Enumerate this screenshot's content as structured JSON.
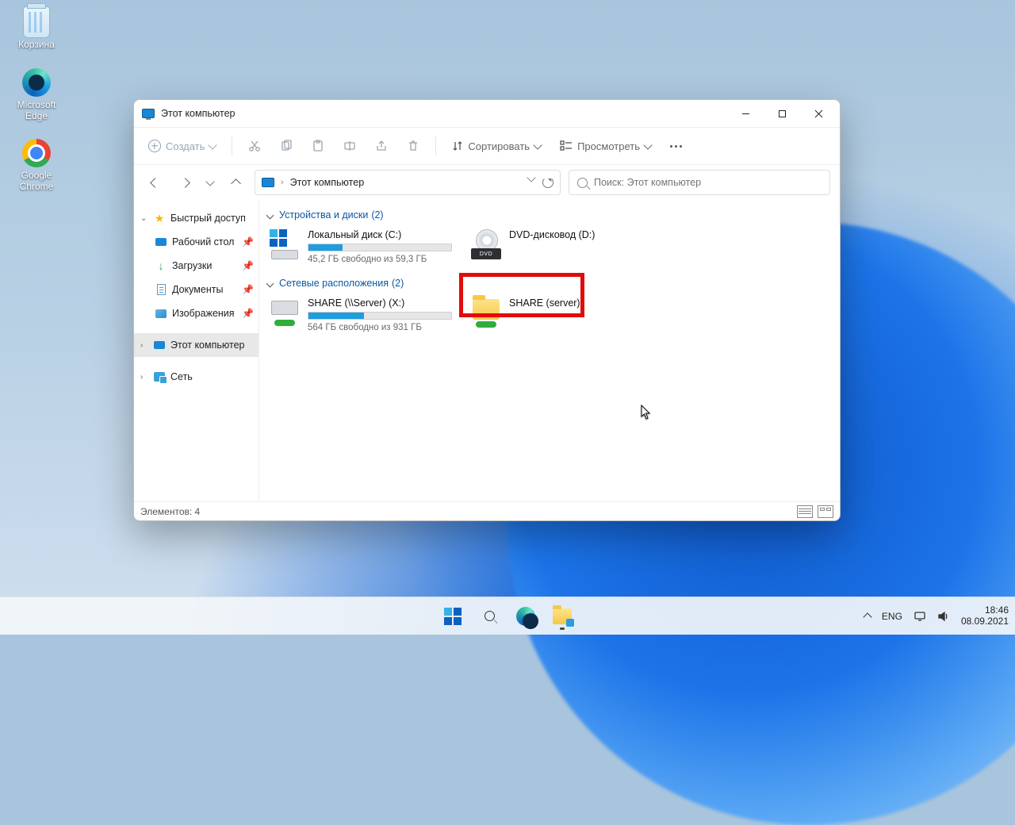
{
  "desktop": {
    "recycle": "Корзина",
    "edge": "Microsoft\nEdge",
    "chrome": "Google\nChrome"
  },
  "window": {
    "title": "Этот компьютер",
    "toolbar": {
      "create": "Создать",
      "sort": "Сортировать",
      "view": "Просмотреть"
    },
    "address": {
      "location": "Этот компьютер"
    },
    "search": {
      "placeholder": "Поиск: Этот компьютер"
    },
    "sidebar": {
      "quick": "Быстрый доступ",
      "desktop": "Рабочий стол",
      "downloads": "Загрузки",
      "documents": "Документы",
      "pictures": "Изображения",
      "thispc": "Этот компьютер",
      "network": "Сеть"
    },
    "groups": {
      "devices": {
        "title": "Устройства и диски",
        "count": "(2)"
      },
      "network": {
        "title": "Сетевые расположения",
        "count": "(2)"
      }
    },
    "items": {
      "cdrive": {
        "name": "Локальный диск (C:)",
        "sub": "45,2 ГБ свободно из 59,3 ГБ",
        "fill_pct": 24
      },
      "dvd": {
        "name": "DVD-дисковод (D:)"
      },
      "share_x": {
        "name": "SHARE (\\\\Server) (X:)",
        "sub": "564 ГБ свободно из 931 ГБ",
        "fill_pct": 39
      },
      "share_s": {
        "name": "SHARE (server)"
      }
    },
    "status": "Элементов: 4"
  },
  "taskbar": {
    "lang": "ENG",
    "time": "18:46",
    "date": "08.09.2021"
  }
}
